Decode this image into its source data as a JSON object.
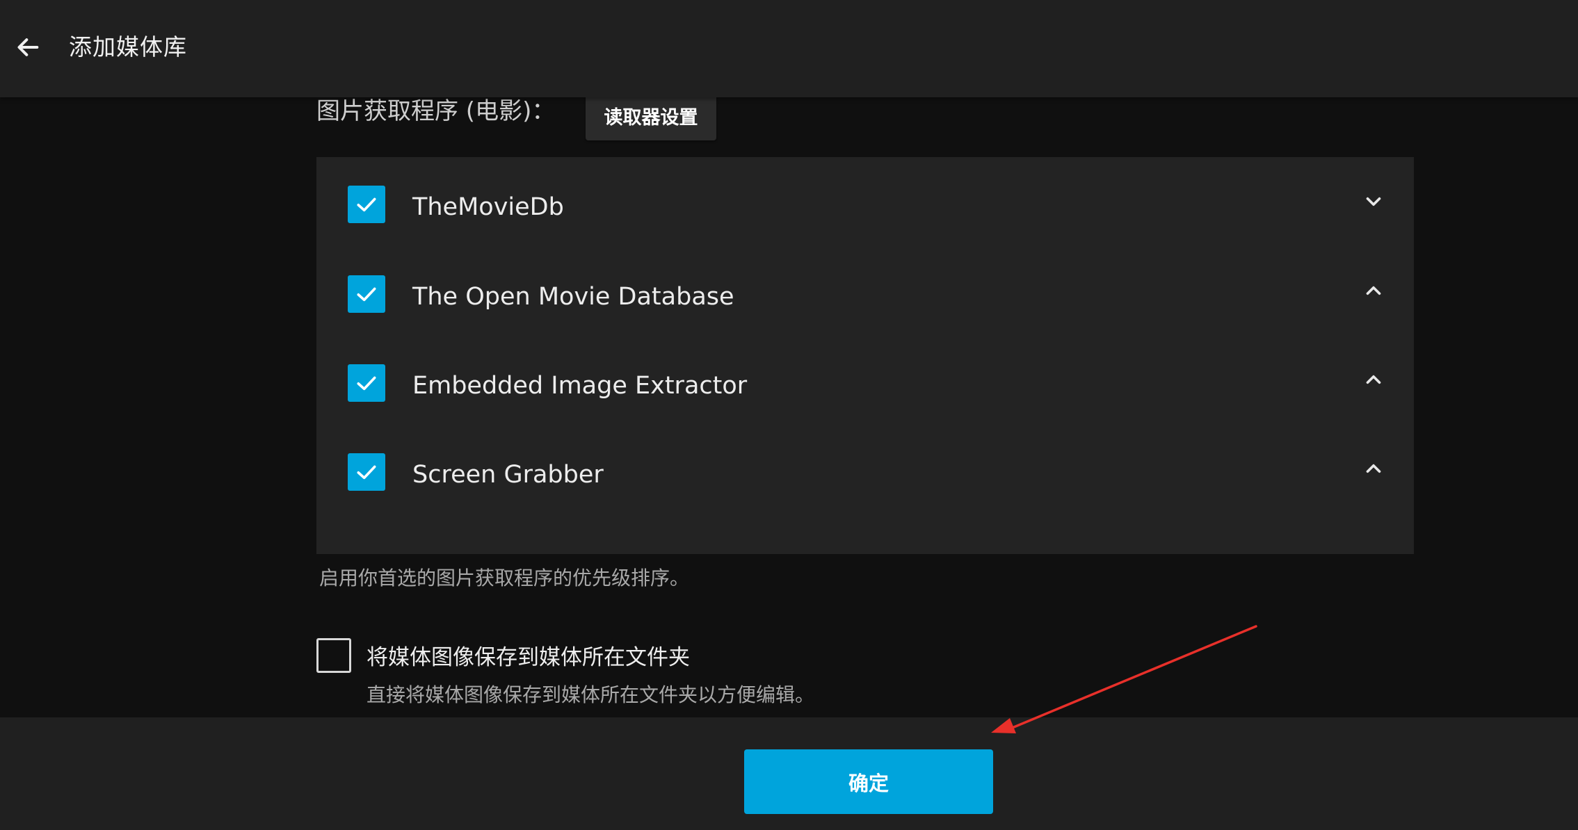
{
  "header": {
    "title": "添加媒体库"
  },
  "image_fetchers": {
    "label": "图片获取程序 (电影)：",
    "settings_button_label": "读取器设置",
    "items": [
      {
        "name": "TheMovieDb",
        "checked": true,
        "chevron": "chevron-down-icon"
      },
      {
        "name": "The Open Movie Database",
        "checked": true,
        "chevron": "chevron-up-icon"
      },
      {
        "name": "Embedded Image Extractor",
        "checked": true,
        "chevron": "chevron-up-icon"
      },
      {
        "name": "Screen Grabber",
        "checked": true,
        "chevron": "chevron-up-icon"
      }
    ],
    "help_text": "启用你首选的图片获取程序的优先级排序。"
  },
  "save_images": {
    "checked": false,
    "label": "将媒体图像保存到媒体所在文件夹",
    "description": "直接将媒体图像保存到媒体所在文件夹以方便编辑。"
  },
  "footer": {
    "ok_label": "确定"
  },
  "colors": {
    "accent": "#00a4dc",
    "annotation_arrow": "#e8302a",
    "header_bg": "#202020",
    "list_bg": "#232323",
    "page_bg": "#101010"
  }
}
